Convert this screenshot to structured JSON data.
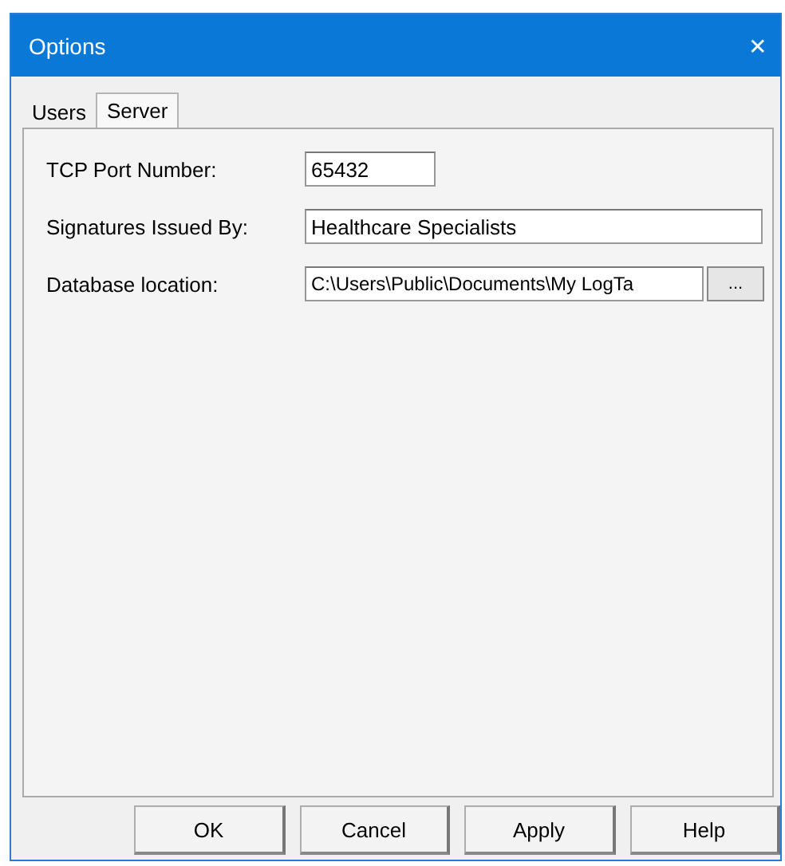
{
  "window": {
    "title": "Options",
    "close": "✕"
  },
  "tabs": [
    {
      "label": "Users",
      "selected": false
    },
    {
      "label": "Server",
      "selected": true
    }
  ],
  "fields": [
    {
      "label": "TCP Port Number:",
      "value": "65432",
      "kind": "short"
    },
    {
      "label": "Signatures Issued By:",
      "value": "Healthcare Specialists",
      "kind": "wide"
    },
    {
      "label": "Database location:",
      "value": "C:\\Users\\Public\\Documents\\My LogTa",
      "kind": "browse",
      "browse": "..."
    }
  ],
  "buttons": [
    "OK",
    "Cancel",
    "Apply",
    "Help"
  ]
}
